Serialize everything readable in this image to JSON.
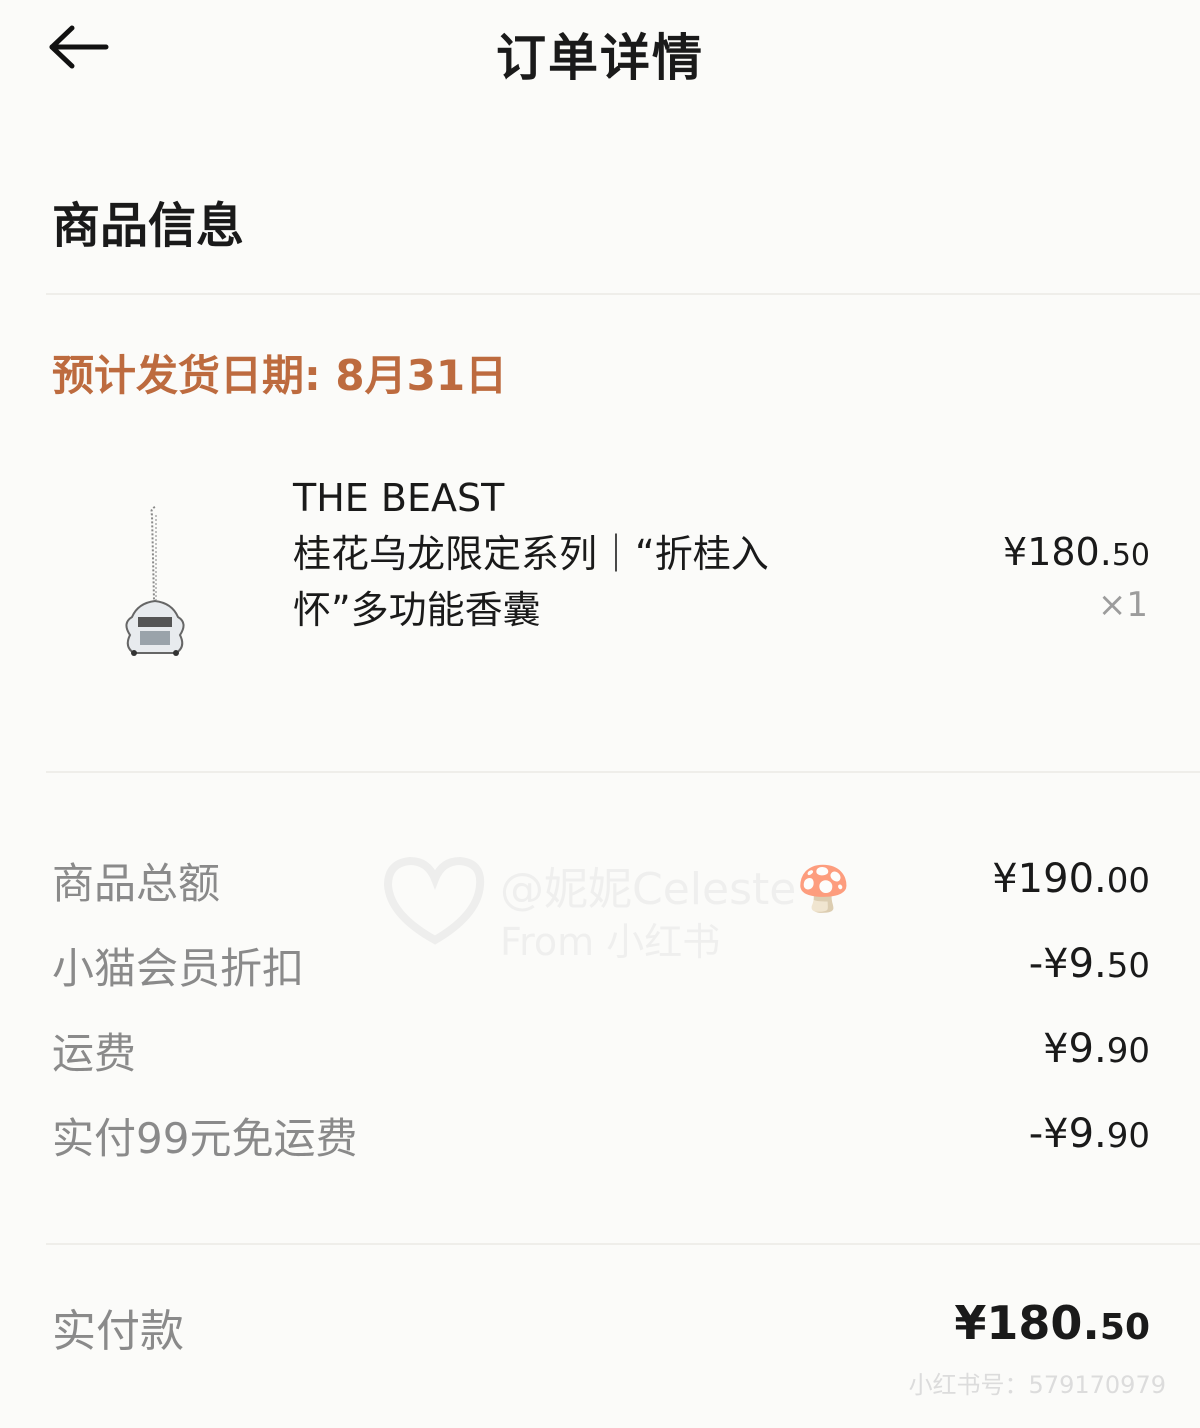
{
  "header": {
    "back_icon": "arrow-left-icon",
    "title": "订单详情"
  },
  "section": {
    "title": "商品信息"
  },
  "shipping": {
    "text": "预计发货日期: 8月31日",
    "color": "#bd6b3f"
  },
  "product": {
    "name_line1": "THE BEAST",
    "name_line2": "桂花乌龙限定系列｜“折桂入",
    "name_line3": "怀”多功能香囊",
    "price_main": "¥180.",
    "price_cents": "50",
    "quantity": "×1",
    "image_icon": "sachet-pendant-image"
  },
  "fees": [
    {
      "label": "商品总额",
      "value_main": "¥190.",
      "value_cents": "00"
    },
    {
      "label": "小猫会员折扣",
      "value_main": "-¥9.",
      "value_cents": "50"
    },
    {
      "label": "运费",
      "value_main": "¥9.",
      "value_cents": "90"
    },
    {
      "label": "实付99元免运费",
      "value_main": "-¥9.",
      "value_cents": "90"
    }
  ],
  "total": {
    "label": "实付款",
    "value_main": "¥180.",
    "value_cents": "50"
  },
  "watermark": {
    "line1": "@妮妮Celeste🍄",
    "line2": "From 小红书",
    "id_text": "小红书号：579170979"
  }
}
